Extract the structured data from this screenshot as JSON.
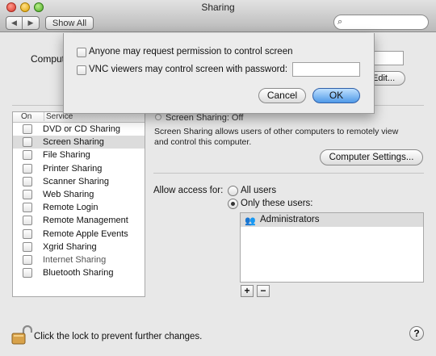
{
  "window": {
    "title": "Sharing"
  },
  "toolbar": {
    "back_glyph": "◀",
    "forward_glyph": "▶",
    "show_all": "Show All",
    "search_icon": "⌕"
  },
  "computer": {
    "label": "Comput",
    "edit_label": "Edit..."
  },
  "services": {
    "headers": {
      "on": "On",
      "service": "Service"
    },
    "items": [
      {
        "label": "DVD or CD Sharing"
      },
      {
        "label": "Screen Sharing"
      },
      {
        "label": "File Sharing"
      },
      {
        "label": "Printer Sharing"
      },
      {
        "label": "Scanner Sharing"
      },
      {
        "label": "Web Sharing"
      },
      {
        "label": "Remote Login"
      },
      {
        "label": "Remote Management"
      },
      {
        "label": "Remote Apple Events"
      },
      {
        "label": "Xgrid Sharing"
      },
      {
        "label": "Internet Sharing"
      },
      {
        "label": "Bluetooth Sharing"
      }
    ],
    "selected_index": 1
  },
  "detail": {
    "status": "Screen Sharing: Off",
    "description": "Screen Sharing allows users of other computers to remotely view and control this computer.",
    "computer_settings": "Computer Settings...",
    "allow_access_label": "Allow access for:",
    "options": {
      "all_users": "All users",
      "only_these": "Only these users:"
    },
    "selected_option": "only_these",
    "users": [
      {
        "icon": "group-icon",
        "name": "Administrators"
      }
    ],
    "plus": "+",
    "minus": "−"
  },
  "sheet": {
    "option1": "Anyone may request permission to control screen",
    "option2": "VNC viewers may control screen with password:",
    "password_value": "",
    "cancel": "Cancel",
    "ok": "OK",
    "ok_color": "#4f9ae8"
  },
  "footer": {
    "lock_text": "Click the lock to prevent further changes.",
    "help": "?"
  }
}
